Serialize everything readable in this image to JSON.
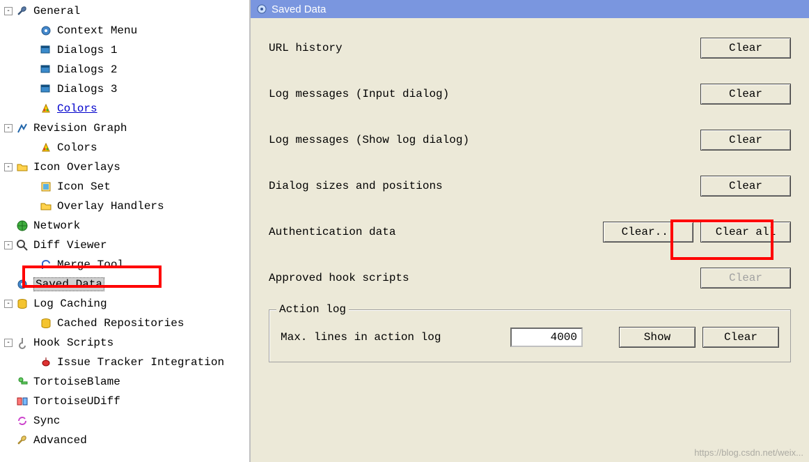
{
  "tree": {
    "general": {
      "label": "General",
      "toggle": "-"
    },
    "context_menu": {
      "label": "Context Menu"
    },
    "dialogs1": {
      "label": "Dialogs 1"
    },
    "dialogs2": {
      "label": "Dialogs 2"
    },
    "dialogs3": {
      "label": "Dialogs 3"
    },
    "colors1": {
      "label": "Colors"
    },
    "revision_graph": {
      "label": "Revision Graph",
      "toggle": "-"
    },
    "colors2": {
      "label": "Colors"
    },
    "icon_overlays": {
      "label": "Icon Overlays",
      "toggle": "-"
    },
    "icon_set": {
      "label": "Icon Set"
    },
    "overlay_hand": {
      "label": "Overlay Handlers"
    },
    "network": {
      "label": "Network"
    },
    "diff_viewer": {
      "label": "Diff Viewer",
      "toggle": "-"
    },
    "merge_tool": {
      "label": "Merge Tool"
    },
    "saved_data": {
      "label": "Saved Data"
    },
    "log_caching": {
      "label": "Log Caching",
      "toggle": "-"
    },
    "cached_repos": {
      "label": "Cached Repositories"
    },
    "hook_scripts": {
      "label": "Hook Scripts",
      "toggle": "-"
    },
    "issue_tracker": {
      "label": "Issue Tracker Integration"
    },
    "tortoiseblame": {
      "label": "TortoiseBlame"
    },
    "tortoiseudiff": {
      "label": "TortoiseUDiff"
    },
    "sync": {
      "label": "Sync"
    },
    "advanced": {
      "label": "Advanced"
    }
  },
  "panel": {
    "title": "Saved Data",
    "rows": {
      "url_history": {
        "label": "URL history",
        "btn": "Clear"
      },
      "log_input": {
        "label": "Log messages (Input dialog)",
        "btn": "Clear"
      },
      "log_show": {
        "label": "Log messages (Show log dialog)",
        "btn": "Clear"
      },
      "dlg_sizes": {
        "label": "Dialog sizes and positions",
        "btn": "Clear"
      },
      "auth": {
        "label": "Authentication data",
        "btn1": "Clear...",
        "btn2": "Clear all"
      },
      "hooks": {
        "label": "Approved hook scripts",
        "btn": "Clear"
      }
    },
    "actionlog": {
      "title": "Action log",
      "label": "Max. lines in action log",
      "value": "4000",
      "show": "Show",
      "clear": "Clear"
    }
  },
  "watermark": "https://blog.csdn.net/weix..."
}
